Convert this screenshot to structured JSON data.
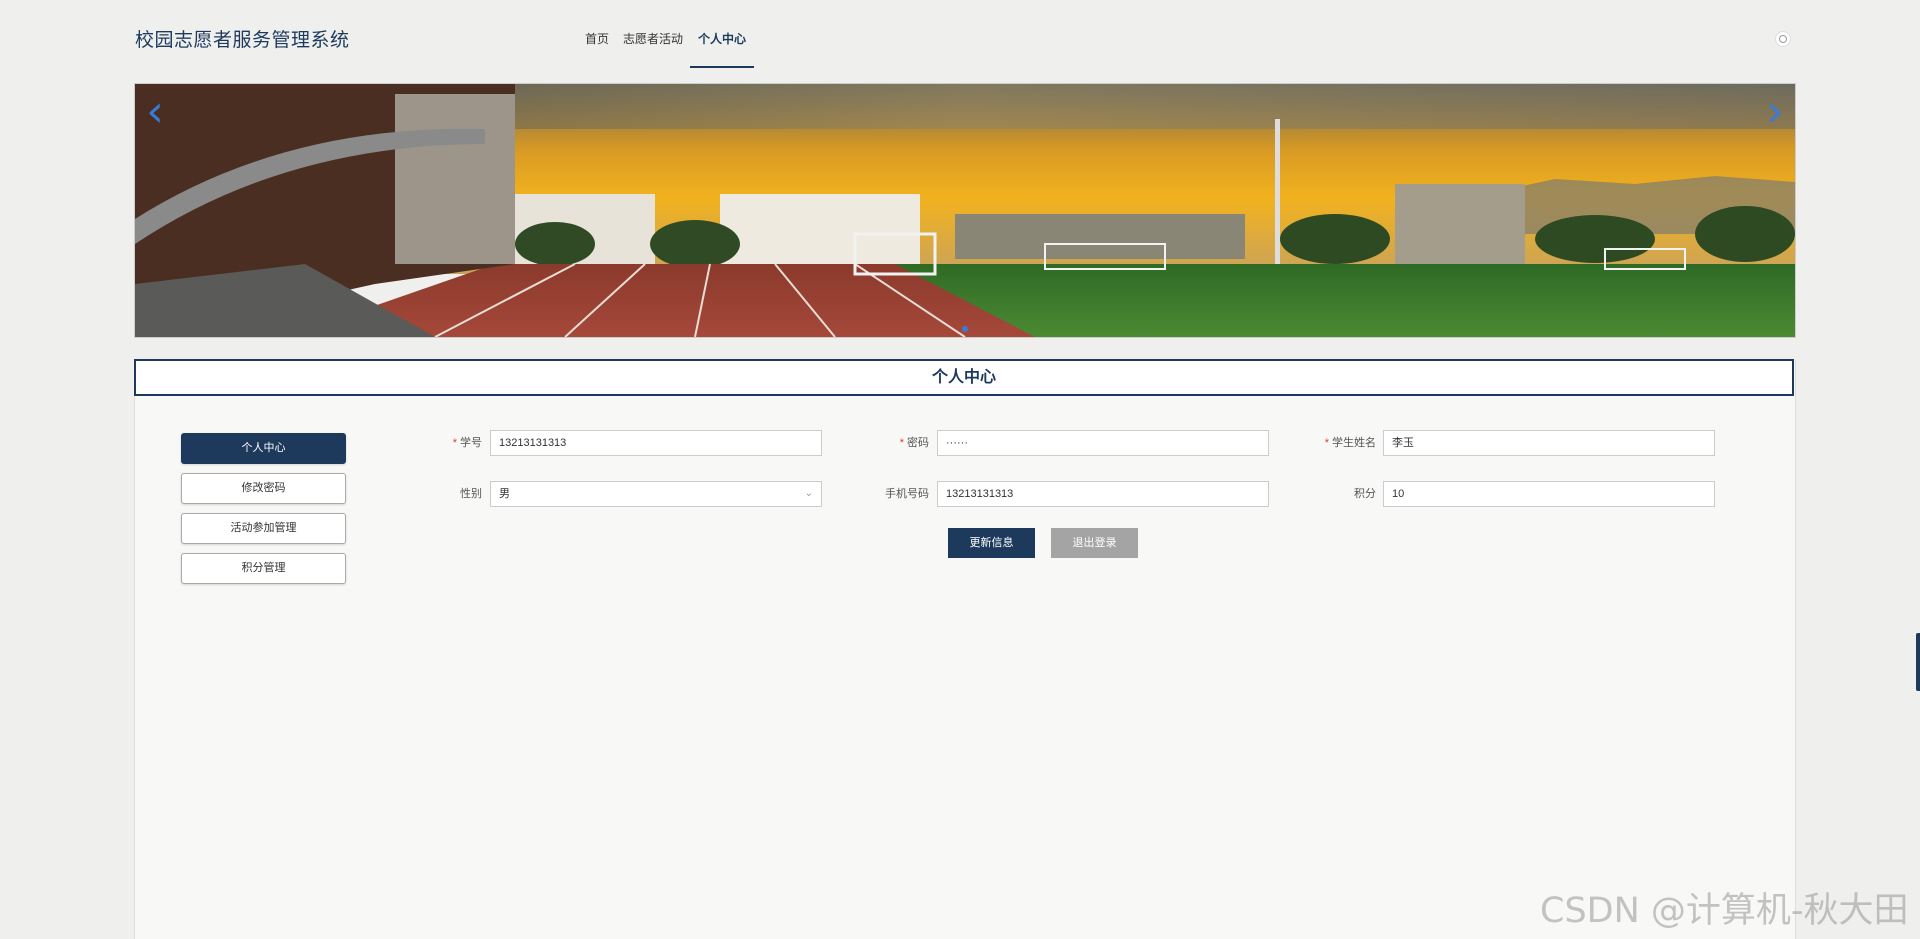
{
  "header": {
    "site_title": "校园志愿者服务管理系统",
    "nav": [
      {
        "label": "首页",
        "active": false
      },
      {
        "label": "志愿者活动",
        "active": false
      },
      {
        "label": "个人中心",
        "active": true
      }
    ]
  },
  "banner": {
    "prev_icon": "chevron-left-icon",
    "next_icon": "chevron-right-icon",
    "prev_glyph": "‹",
    "next_glyph": "›"
  },
  "section_title": "个人中心",
  "side_menu": [
    {
      "label": "个人中心",
      "active": true
    },
    {
      "label": "修改密码",
      "active": false
    },
    {
      "label": "活动参加管理",
      "active": false
    },
    {
      "label": "积分管理",
      "active": false
    }
  ],
  "form": {
    "student_no": {
      "label": "学号",
      "required": true,
      "value": "13213131313"
    },
    "password": {
      "label": "密码",
      "required": true,
      "value": "······"
    },
    "student_name": {
      "label": "学生姓名",
      "required": true,
      "value": "李玉"
    },
    "gender": {
      "label": "性别",
      "required": false,
      "value": "男"
    },
    "phone": {
      "label": "手机号码",
      "required": false,
      "value": "13213131313"
    },
    "points": {
      "label": "积分",
      "required": false,
      "value": "10"
    }
  },
  "buttons": {
    "update": "更新信息",
    "logout": "退出登录"
  },
  "watermark": "CSDN @计算机-秋大田",
  "colors": {
    "primary": "#1d3a5c",
    "secondary_button": "#a4a4a4",
    "page_background": "#efefed",
    "banner_arrow": "#3a7bd5"
  }
}
